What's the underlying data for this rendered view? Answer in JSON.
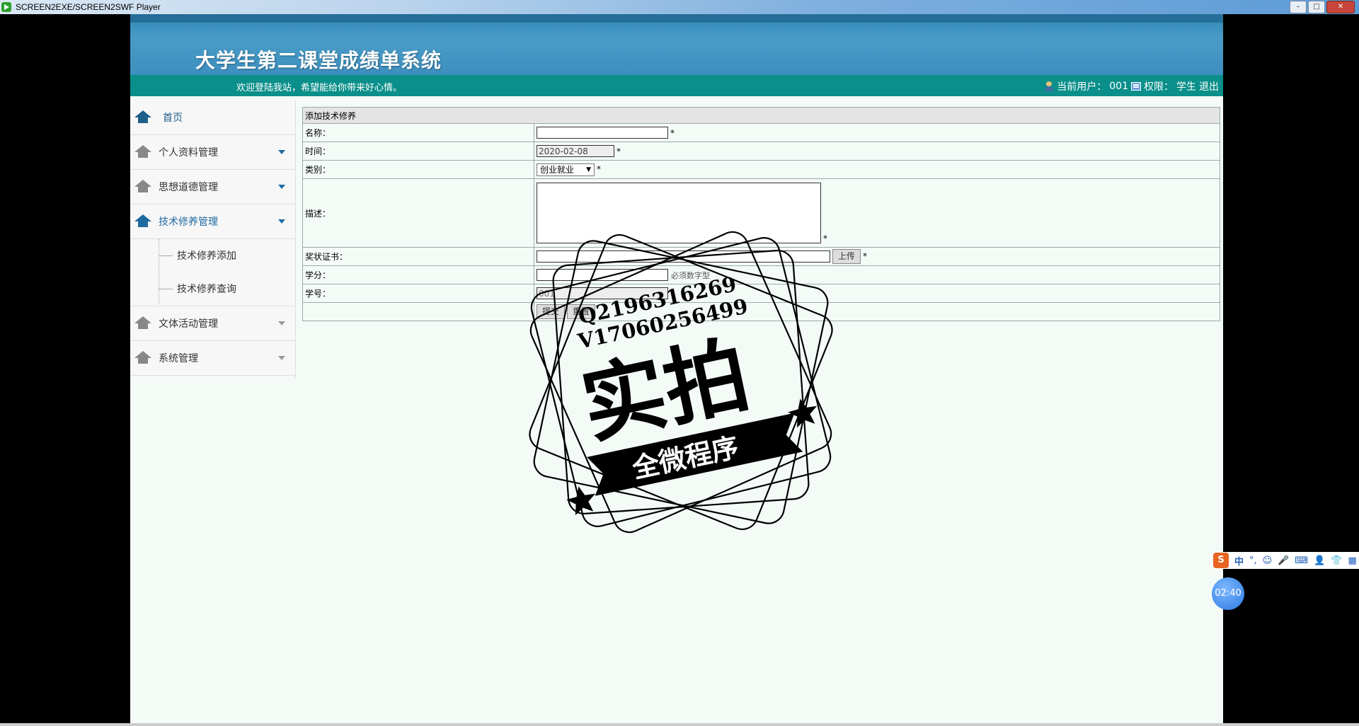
{
  "window": {
    "title": "SCREEN2EXE/SCREEN2SWF Player",
    "min": "–",
    "max": "□",
    "close": "✕"
  },
  "header": {
    "title": "大学生第二课堂成绩单系统",
    "welcome": "欢迎登陆我站，希望能给你带来好心情。",
    "current_user_label": "当前用户：",
    "current_user": "001",
    "perm_label": "权限：",
    "perm": "学生",
    "logout": "退出"
  },
  "sidebar": {
    "home": "首页",
    "items": [
      {
        "label": "个人资料管理"
      },
      {
        "label": "思想道德管理"
      },
      {
        "label": "技术修养管理",
        "sub": [
          "技术修养添加",
          "技术修养查询"
        ]
      },
      {
        "label": "文体活动管理"
      },
      {
        "label": "系统管理"
      }
    ]
  },
  "form": {
    "title": "添加技术修养",
    "name_label": "名称：",
    "time_label": "时间：",
    "time_value": "2020-02-08",
    "category_label": "类别：",
    "category_value": "创业就业",
    "desc_label": "描述：",
    "cert_label": "奖状证书：",
    "upload_btn": "上传",
    "credit_label": "学分：",
    "credit_hint": "必须数字型",
    "sid_label": "学号：",
    "sid_value": "001",
    "submit_btn": "提交",
    "reset_btn": "重置",
    "required": "*"
  },
  "watermark": {
    "qq": "Q2196316269",
    "wx": "V17060256499",
    "big": "实拍",
    "ribbon": "全微程序"
  },
  "ime": {
    "lang": "中",
    "punct": "°,"
  },
  "timer": "02:40"
}
